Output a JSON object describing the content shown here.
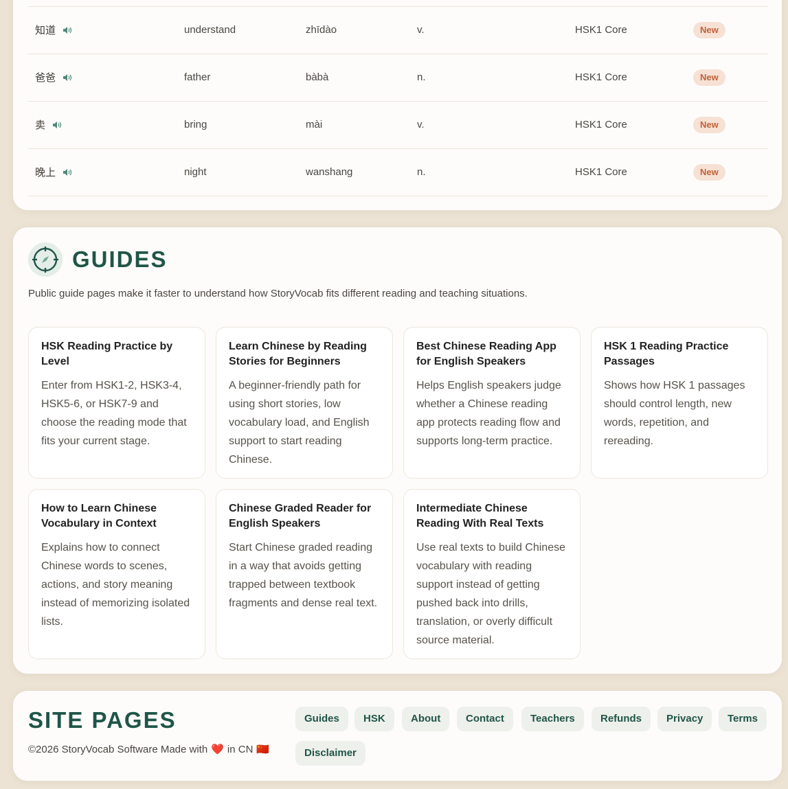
{
  "vocab": {
    "rows": [
      {
        "hanzi": "知道",
        "meaning": "understand",
        "pinyin": "zhīdào",
        "pos": "v.",
        "level": "HSK1 Core",
        "status": "New"
      },
      {
        "hanzi": "爸爸",
        "meaning": "father",
        "pinyin": "bàbà",
        "pos": "n.",
        "level": "HSK1 Core",
        "status": "New"
      },
      {
        "hanzi": "卖",
        "meaning": "bring",
        "pinyin": "mài",
        "pos": "v.",
        "level": "HSK1 Core",
        "status": "New"
      },
      {
        "hanzi": "晚上",
        "meaning": "night",
        "pinyin": "wanshang",
        "pos": "n.",
        "level": "HSK1 Core",
        "status": "New"
      }
    ]
  },
  "guides": {
    "title": "GUIDES",
    "description": "Public guide pages make it faster to understand how StoryVocab fits different reading and teaching situations.",
    "items": [
      {
        "title": "HSK Reading Practice by Level",
        "body": "Enter from HSK1-2, HSK3-4, HSK5-6, or HSK7-9 and choose the reading mode that fits your current stage."
      },
      {
        "title": "Learn Chinese by Reading Stories for Beginners",
        "body": "A beginner-friendly path for using short stories, low vocabulary load, and English support to start reading Chinese."
      },
      {
        "title": "Best Chinese Reading App for English Speakers",
        "body": "Helps English speakers judge whether a Chinese reading app protects reading flow and supports long-term practice."
      },
      {
        "title": "HSK 1 Reading Practice Passages",
        "body": "Shows how HSK 1 passages should control length, new words, repetition, and rereading."
      },
      {
        "title": "How to Learn Chinese Vocabulary in Context",
        "body": "Explains how to connect Chinese words to scenes, actions, and story meaning instead of memorizing isolated lists."
      },
      {
        "title": "Chinese Graded Reader for English Speakers",
        "body": "Start Chinese graded reading in a way that avoids getting trapped between textbook fragments and dense real text."
      },
      {
        "title": "Intermediate Chinese Reading With Real Texts",
        "body": "Use real texts to build Chinese vocabulary with reading support instead of getting pushed back into drills, translation, or overly difficult source material."
      }
    ]
  },
  "site": {
    "title": "SITE PAGES",
    "copyright_prefix": "©2026 StoryVocab Software Made with",
    "copyright_mid": "in CN",
    "heart": "❤️",
    "flag": "🇨🇳",
    "links": [
      "Guides",
      "HSK",
      "About",
      "Contact",
      "Teachers",
      "Refunds",
      "Privacy",
      "Terms",
      "Disclaimer"
    ]
  },
  "colors": {
    "accent": "#1f5548",
    "badge_bg": "#f6e1d4",
    "badge_text": "#c0623a",
    "page_bg": "#ede3d4"
  }
}
